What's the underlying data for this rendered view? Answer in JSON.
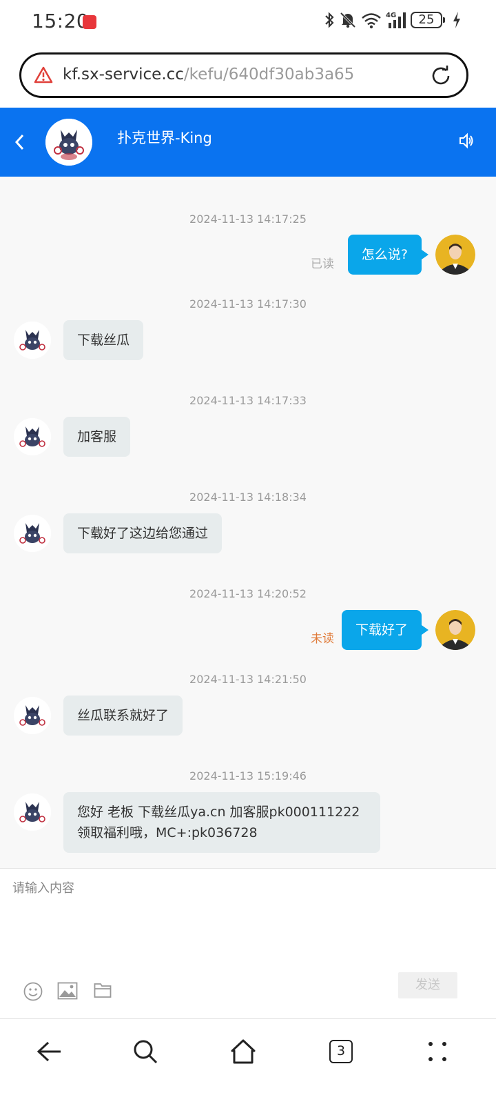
{
  "status_bar": {
    "time": "15:20",
    "battery": "25",
    "network": "4G"
  },
  "browser": {
    "url_host": "kf.sx-service.cc",
    "url_path": "/kefu/640df30ab3a65",
    "tab_count": "3"
  },
  "chat": {
    "title": "扑克世界-King",
    "messages": [
      {
        "time": "2024-11-13 14:17:25",
        "side": "right",
        "text": "怎么说?",
        "status": "已读"
      },
      {
        "time": "2024-11-13 14:17:30",
        "side": "left",
        "text": "下载丝瓜"
      },
      {
        "time": "2024-11-13 14:17:33",
        "side": "left",
        "text": "加客服"
      },
      {
        "time": "2024-11-13 14:18:34",
        "side": "left",
        "text": "下载好了这边给您通过"
      },
      {
        "time": "2024-11-13 14:20:52",
        "side": "right",
        "text": "下载好了",
        "status": "未读"
      },
      {
        "time": "2024-11-13 14:21:50",
        "side": "left",
        "text": "丝瓜联系就好了"
      },
      {
        "time": "2024-11-13 15:19:46",
        "side": "left",
        "text_line1": "您好 老板 下载丝瓜ya.cn 加客服pk000111222",
        "text_line2": "领取福利哦，MC+:pk036728"
      }
    ]
  },
  "input": {
    "placeholder": "请输入内容",
    "send_label": "发送"
  },
  "colors": {
    "header": "#0a73f0",
    "user_bubble": "#0aa6ea",
    "bot_bubble": "#e7eced",
    "unread": "#e07b3a",
    "read": "#aaaaaa"
  }
}
